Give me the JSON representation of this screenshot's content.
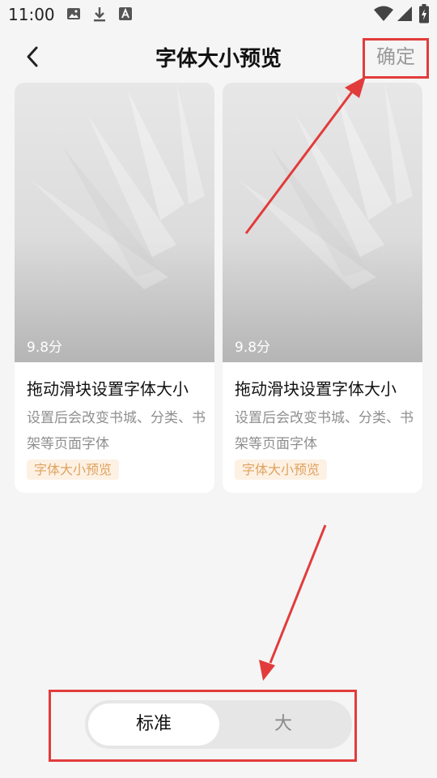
{
  "status_bar": {
    "time": "11:00"
  },
  "header": {
    "title": "字体大小预览",
    "confirm_label": "确定"
  },
  "cards": [
    {
      "score": "9.8分",
      "title": "拖动滑块设置字体大小",
      "description": "设置后会改变书城、分类、书架等页面字体",
      "tag": "字体大小预览"
    },
    {
      "score": "9.8分",
      "title": "拖动滑块设置字体大小",
      "description": "设置后会改变书城、分类、书架等页面字体",
      "tag": "字体大小预览"
    }
  ],
  "size_toggle": {
    "options": [
      "标准",
      "大"
    ],
    "selected": "标准"
  },
  "colors": {
    "background": "#f5f5f5",
    "card": "#ffffff",
    "annotation_red": "#e23b3b",
    "tag_text": "#e0a25e",
    "tag_bg": "#fdf1e4"
  }
}
